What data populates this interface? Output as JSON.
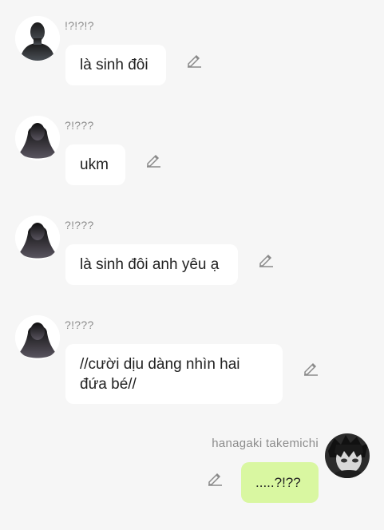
{
  "messages": [
    {
      "sender": "!?!?!?",
      "text": "là sinh đôi",
      "avatar_icon": "male-silhouette-icon",
      "edit_icon": "edit-pencil-icon"
    },
    {
      "sender": "?!???",
      "text": "ukm",
      "avatar_icon": "female-silhouette-icon",
      "edit_icon": "edit-pencil-icon"
    },
    {
      "sender": "?!???",
      "text": "là sinh đôi anh yêu ạ",
      "avatar_icon": "female-silhouette-icon",
      "edit_icon": "edit-pencil-icon"
    },
    {
      "sender": "?!???",
      "text": "//cười dịu dàng nhìn hai\nđứa bé//",
      "avatar_icon": "female-silhouette-icon",
      "edit_icon": "edit-pencil-icon"
    },
    {
      "sender": "hanagaki takemichi",
      "text": ".....?!??",
      "avatar_icon": "anime-boy-avatar-icon",
      "edit_icon": "edit-pencil-icon"
    }
  ],
  "colors": {
    "background": "#f6f6f6",
    "incoming_bubble": "#ffffff",
    "outgoing_bubble": "#d9f7a1",
    "sender_name": "#8c8c8c"
  }
}
